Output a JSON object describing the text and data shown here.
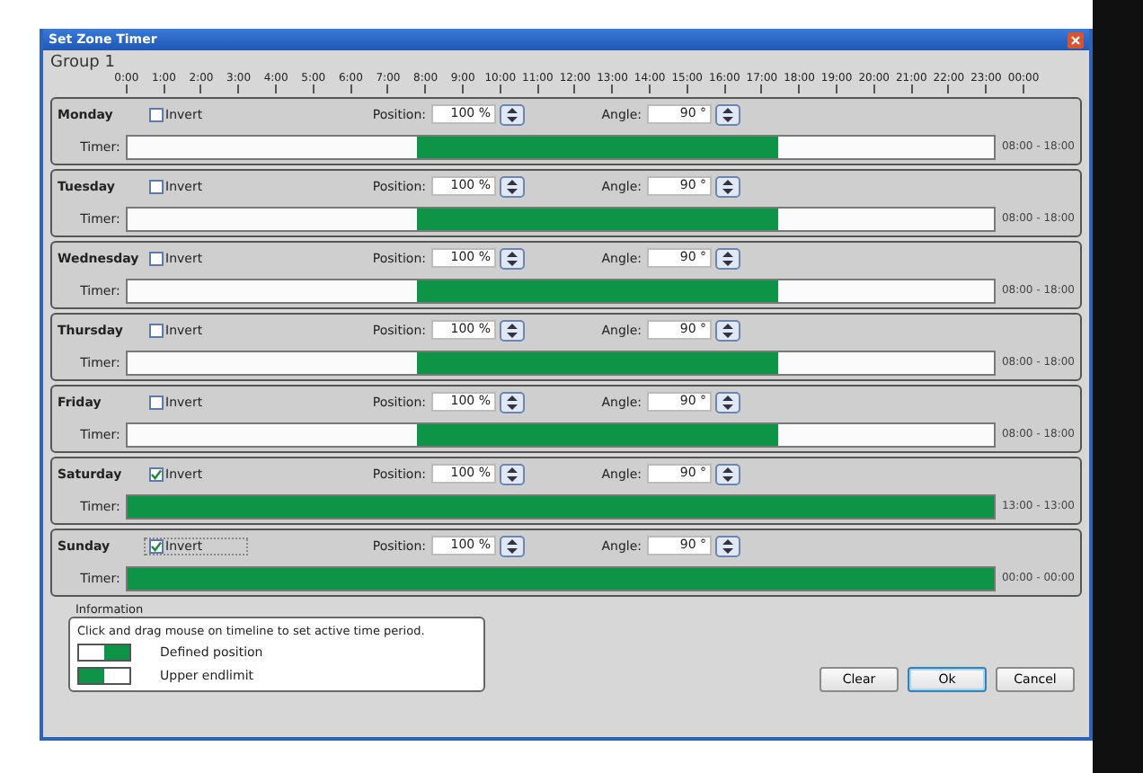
{
  "window": {
    "title": "Set Zone Timer"
  },
  "group": {
    "title": "Group 1"
  },
  "timeline": {
    "labels": [
      "0:00",
      "1:00",
      "2:00",
      "3:00",
      "4:00",
      "5:00",
      "6:00",
      "7:00",
      "8:00",
      "9:00",
      "10:00",
      "11:00",
      "12:00",
      "13:00",
      "14:00",
      "15:00",
      "16:00",
      "17:00",
      "18:00",
      "19:00",
      "20:00",
      "21:00",
      "22:00",
      "23:00",
      "00:00"
    ]
  },
  "days": [
    {
      "name": "Monday",
      "invert": {
        "label": "Invert",
        "checked": false,
        "focused": false
      },
      "position": {
        "label": "Position:",
        "value": "100 %"
      },
      "angle": {
        "label": "Angle:",
        "value": "90 °"
      },
      "timer": {
        "label": "Timer:",
        "hours": [
          false,
          false,
          false,
          false,
          false,
          false,
          false,
          false,
          true,
          true,
          true,
          true,
          true,
          true,
          true,
          true,
          true,
          true,
          false,
          false,
          false,
          false,
          false,
          false
        ],
        "reading": "08:00 - 18:00"
      }
    },
    {
      "name": "Tuesday",
      "invert": {
        "label": "Invert",
        "checked": false,
        "focused": false
      },
      "position": {
        "label": "Position:",
        "value": "100 %"
      },
      "angle": {
        "label": "Angle:",
        "value": "90 °"
      },
      "timer": {
        "label": "Timer:",
        "hours": [
          false,
          false,
          false,
          false,
          false,
          false,
          false,
          false,
          true,
          true,
          true,
          true,
          true,
          true,
          true,
          true,
          true,
          true,
          false,
          false,
          false,
          false,
          false,
          false
        ],
        "reading": "08:00 - 18:00"
      }
    },
    {
      "name": "Wednesday",
      "invert": {
        "label": "Invert",
        "checked": false,
        "focused": false
      },
      "position": {
        "label": "Position:",
        "value": "100 %"
      },
      "angle": {
        "label": "Angle:",
        "value": "90 °"
      },
      "timer": {
        "label": "Timer:",
        "hours": [
          false,
          false,
          false,
          false,
          false,
          false,
          false,
          false,
          true,
          true,
          true,
          true,
          true,
          true,
          true,
          true,
          true,
          true,
          false,
          false,
          false,
          false,
          false,
          false
        ],
        "reading": "08:00 - 18:00"
      }
    },
    {
      "name": "Thursday",
      "invert": {
        "label": "Invert",
        "checked": false,
        "focused": false
      },
      "position": {
        "label": "Position:",
        "value": "100 %"
      },
      "angle": {
        "label": "Angle:",
        "value": "90 °"
      },
      "timer": {
        "label": "Timer:",
        "hours": [
          false,
          false,
          false,
          false,
          false,
          false,
          false,
          false,
          true,
          true,
          true,
          true,
          true,
          true,
          true,
          true,
          true,
          true,
          false,
          false,
          false,
          false,
          false,
          false
        ],
        "reading": "08:00 - 18:00"
      }
    },
    {
      "name": "Friday",
      "invert": {
        "label": "Invert",
        "checked": false,
        "focused": false
      },
      "position": {
        "label": "Position:",
        "value": "100 %"
      },
      "angle": {
        "label": "Angle:",
        "value": "90 °"
      },
      "timer": {
        "label": "Timer:",
        "hours": [
          false,
          false,
          false,
          false,
          false,
          false,
          false,
          false,
          true,
          true,
          true,
          true,
          true,
          true,
          true,
          true,
          true,
          true,
          false,
          false,
          false,
          false,
          false,
          false
        ],
        "reading": "08:00 - 18:00"
      }
    },
    {
      "name": "Saturday",
      "invert": {
        "label": "Invert",
        "checked": true,
        "focused": false
      },
      "position": {
        "label": "Position:",
        "value": "100 %"
      },
      "angle": {
        "label": "Angle:",
        "value": "90 °"
      },
      "timer": {
        "label": "Timer:",
        "hours": [
          true,
          true,
          true,
          true,
          true,
          true,
          true,
          true,
          true,
          true,
          true,
          true,
          true,
          true,
          true,
          true,
          true,
          true,
          true,
          true,
          true,
          true,
          true,
          true
        ],
        "reading": "13:00 - 13:00"
      }
    },
    {
      "name": "Sunday",
      "invert": {
        "label": "Invert",
        "checked": true,
        "focused": true
      },
      "position": {
        "label": "Position:",
        "value": "100 %"
      },
      "angle": {
        "label": "Angle:",
        "value": "90 °"
      },
      "timer": {
        "label": "Timer:",
        "hours": [
          true,
          true,
          true,
          true,
          true,
          true,
          true,
          true,
          true,
          true,
          true,
          true,
          true,
          true,
          true,
          true,
          true,
          true,
          true,
          true,
          true,
          true,
          true,
          true
        ],
        "reading": "00:00 - 00:00"
      }
    }
  ],
  "information": {
    "title": "Information",
    "text": "Click and drag mouse on timeline to set active time period.",
    "legend": [
      {
        "kind": "defined",
        "label": "Defined position"
      },
      {
        "kind": "upper",
        "label": "Upper endlimit"
      }
    ]
  },
  "buttons": [
    {
      "label": "Clear",
      "default": false
    },
    {
      "label": "Ok",
      "default": true
    },
    {
      "label": "Cancel",
      "default": false
    }
  ]
}
